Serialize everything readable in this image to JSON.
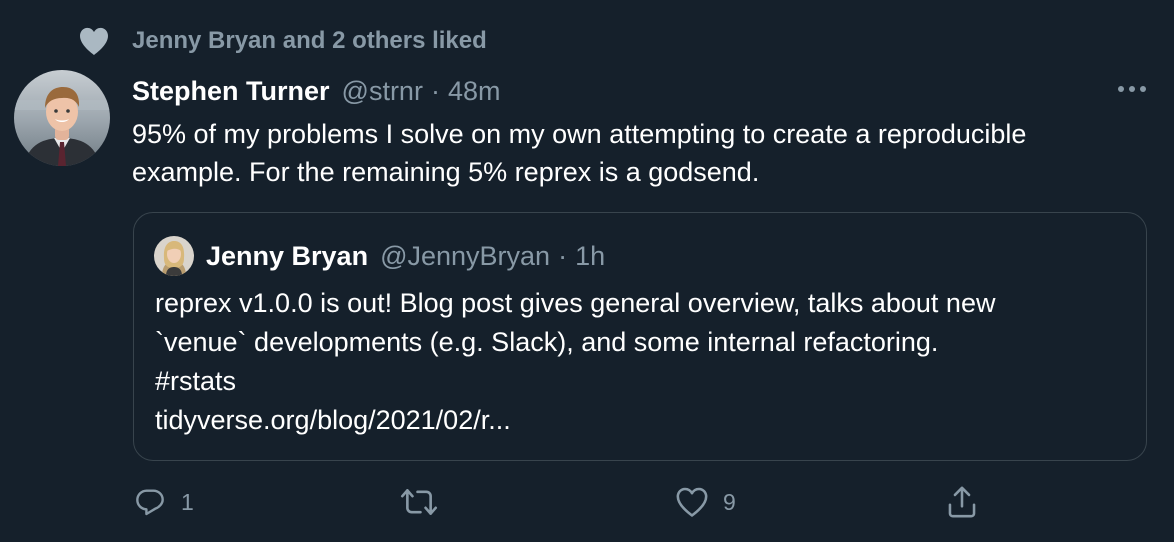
{
  "social_context": {
    "icon": "heart-icon",
    "text": "Jenny Bryan and 2 others liked"
  },
  "tweet": {
    "author_name": "Stephen Turner",
    "author_handle": "@strnr",
    "separator": "·",
    "time": "48m",
    "text": "95% of my problems I solve on my own attempting to create a reproducible example. For the remaining 5% reprex is a godsend."
  },
  "quoted_tweet": {
    "author_name": "Jenny Bryan",
    "author_handle": "@JennyBryan",
    "separator": "·",
    "time": "1h",
    "lines": [
      "reprex v1.0.0 is out! Blog post gives general overview, talks about new",
      "`venue` developments (e.g. Slack), and some internal refactoring.",
      "#rstats",
      "tidyverse.org/blog/2021/02/r..."
    ]
  },
  "actions": {
    "reply": {
      "icon": "reply-icon",
      "count": "1"
    },
    "retweet": {
      "icon": "retweet-icon",
      "count": ""
    },
    "like": {
      "icon": "heart-outline-icon",
      "count": "9"
    },
    "share": {
      "icon": "share-icon"
    }
  },
  "colors": {
    "background": "#15202b",
    "text_primary": "#ffffff",
    "text_secondary": "#8899a6",
    "border": "#38444d",
    "social_heart": "#aab8c2"
  }
}
